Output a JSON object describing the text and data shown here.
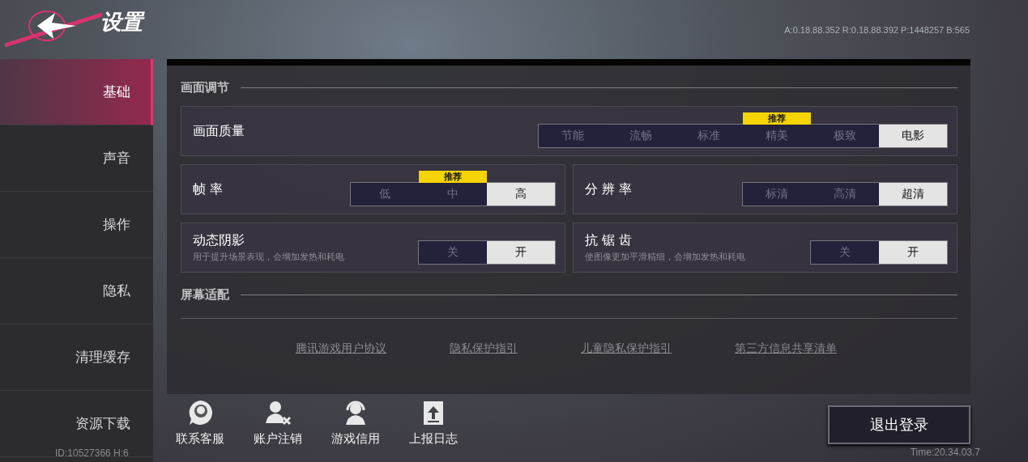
{
  "header": {
    "title": "设置",
    "build_info": "A:0.18.88.352 R:0.18.88.392 P:1448257 B:565"
  },
  "sidebar": {
    "items": [
      {
        "label": "基础",
        "selected": true
      },
      {
        "label": "声音",
        "selected": false
      },
      {
        "label": "操作",
        "selected": false
      },
      {
        "label": "隐私",
        "selected": false
      },
      {
        "label": "清理缓存",
        "selected": false
      },
      {
        "label": "资源下载",
        "selected": false
      }
    ],
    "footer": "ID:10527366 H:6"
  },
  "sections": [
    {
      "title": "画面调节",
      "rows": [
        {
          "settings": [
            {
              "label": "画面质量",
              "options": [
                {
                  "label": "节能",
                  "selected": false
                },
                {
                  "label": "流畅",
                  "selected": false
                },
                {
                  "label": "标准",
                  "selected": false
                },
                {
                  "label": "精美",
                  "selected": false,
                  "badge": "推荐"
                },
                {
                  "label": "极致",
                  "selected": false
                },
                {
                  "label": "电影",
                  "selected": true
                }
              ]
            }
          ]
        },
        {
          "settings": [
            {
              "label": "帧 率",
              "options": [
                {
                  "label": "低",
                  "selected": false
                },
                {
                  "label": "中",
                  "selected": false,
                  "badge": "推荐"
                },
                {
                  "label": "高",
                  "selected": true
                }
              ]
            },
            {
              "label": "分 辨 率",
              "options": [
                {
                  "label": "标清",
                  "selected": false
                },
                {
                  "label": "高清",
                  "selected": false
                },
                {
                  "label": "超清",
                  "selected": true
                }
              ]
            }
          ]
        },
        {
          "settings": [
            {
              "label": "动态阴影",
              "description": "用于提升场景表现，会增加发热和耗电",
              "options": [
                {
                  "label": "关",
                  "selected": false
                },
                {
                  "label": "开",
                  "selected": true
                }
              ]
            },
            {
              "label": "抗 锯 齿",
              "description": "使图像更加平滑精细，会增加发热和耗电",
              "options": [
                {
                  "label": "关",
                  "selected": false
                },
                {
                  "label": "开",
                  "selected": true
                }
              ]
            }
          ]
        }
      ]
    },
    {
      "title": "屏幕适配"
    }
  ],
  "links": [
    "腾讯游戏用户协议",
    "隐私保护指引",
    "儿童隐私保护指引",
    "第三方信息共享清单"
  ],
  "actions": [
    {
      "kind": "support",
      "label": "联系客服"
    },
    {
      "kind": "cancel-account",
      "label": "账户注销"
    },
    {
      "kind": "credit",
      "label": "游戏信用"
    },
    {
      "kind": "report",
      "label": "上报日志"
    }
  ],
  "logout_button": "退出登录",
  "time": "Time:20.34.03.7"
}
